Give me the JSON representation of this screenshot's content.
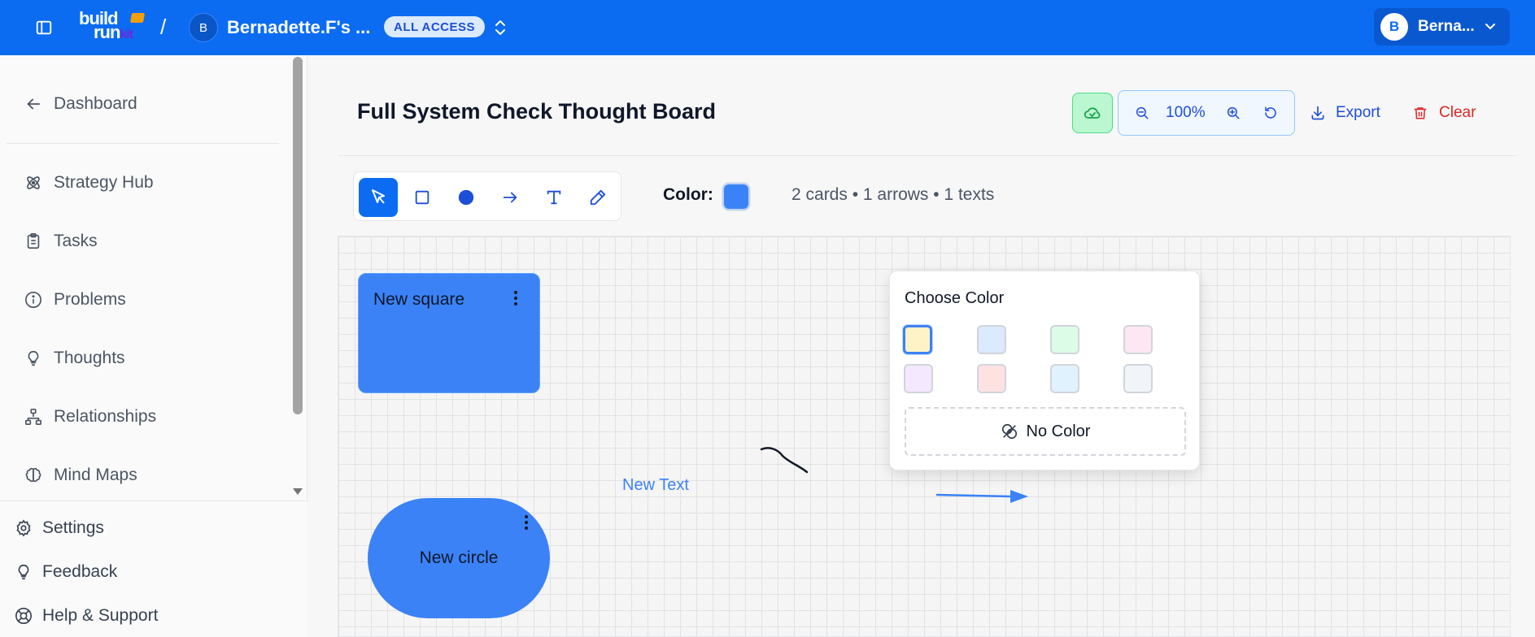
{
  "app": {
    "logo_line1": "build",
    "logo_line2": "run",
    "logo_kit": "kit",
    "separator": "/",
    "workspace_initial": "B",
    "workspace_name": "Bernadette.F's ...",
    "access_badge": "ALL ACCESS",
    "user_initial": "B",
    "user_name": "Berna..."
  },
  "sidebar": {
    "back_label": "Dashboard",
    "items": [
      {
        "label": "Strategy Hub",
        "icon": "atom-icon"
      },
      {
        "label": "Tasks",
        "icon": "clipboard-icon"
      },
      {
        "label": "Problems",
        "icon": "info-icon"
      },
      {
        "label": "Thoughts",
        "icon": "lightbulb-icon"
      },
      {
        "label": "Relationships",
        "icon": "network-icon"
      },
      {
        "label": "Mind Maps",
        "icon": "brain-icon"
      }
    ],
    "bottom": [
      {
        "label": "Settings",
        "icon": "gear-icon"
      },
      {
        "label": "Feedback",
        "icon": "lightbulb-icon"
      },
      {
        "label": "Help & Support",
        "icon": "lifebuoy-icon"
      }
    ]
  },
  "board": {
    "title": "Full System Check Thought Board",
    "zoom": "100%",
    "export_label": "Export",
    "clear_label": "Clear",
    "color_label": "Color:",
    "current_color": "#3b82f6",
    "counts": "2 cards • 1 arrows • 1 texts",
    "tools": [
      "select",
      "rectangle",
      "circle",
      "arrow",
      "text",
      "pen"
    ],
    "active_tool": "select"
  },
  "canvas": {
    "square_card_title": "New square",
    "circle_card_title": "New circle",
    "text_item": "New Text",
    "card_color": "#3b82f6"
  },
  "color_picker": {
    "title": "Choose Color",
    "swatches": [
      "#fef3c7",
      "#dbeafe",
      "#dcfce7",
      "#fce7f3",
      "#f3e8ff",
      "#fee2e2",
      "#e0f2fe",
      "#f1f5f9"
    ],
    "selected_index": 0,
    "no_color_label": "No Color"
  },
  "colors": {
    "brand": "#0b6cf2",
    "danger": "#dc2626",
    "accent_green": "#bbf7d0"
  }
}
